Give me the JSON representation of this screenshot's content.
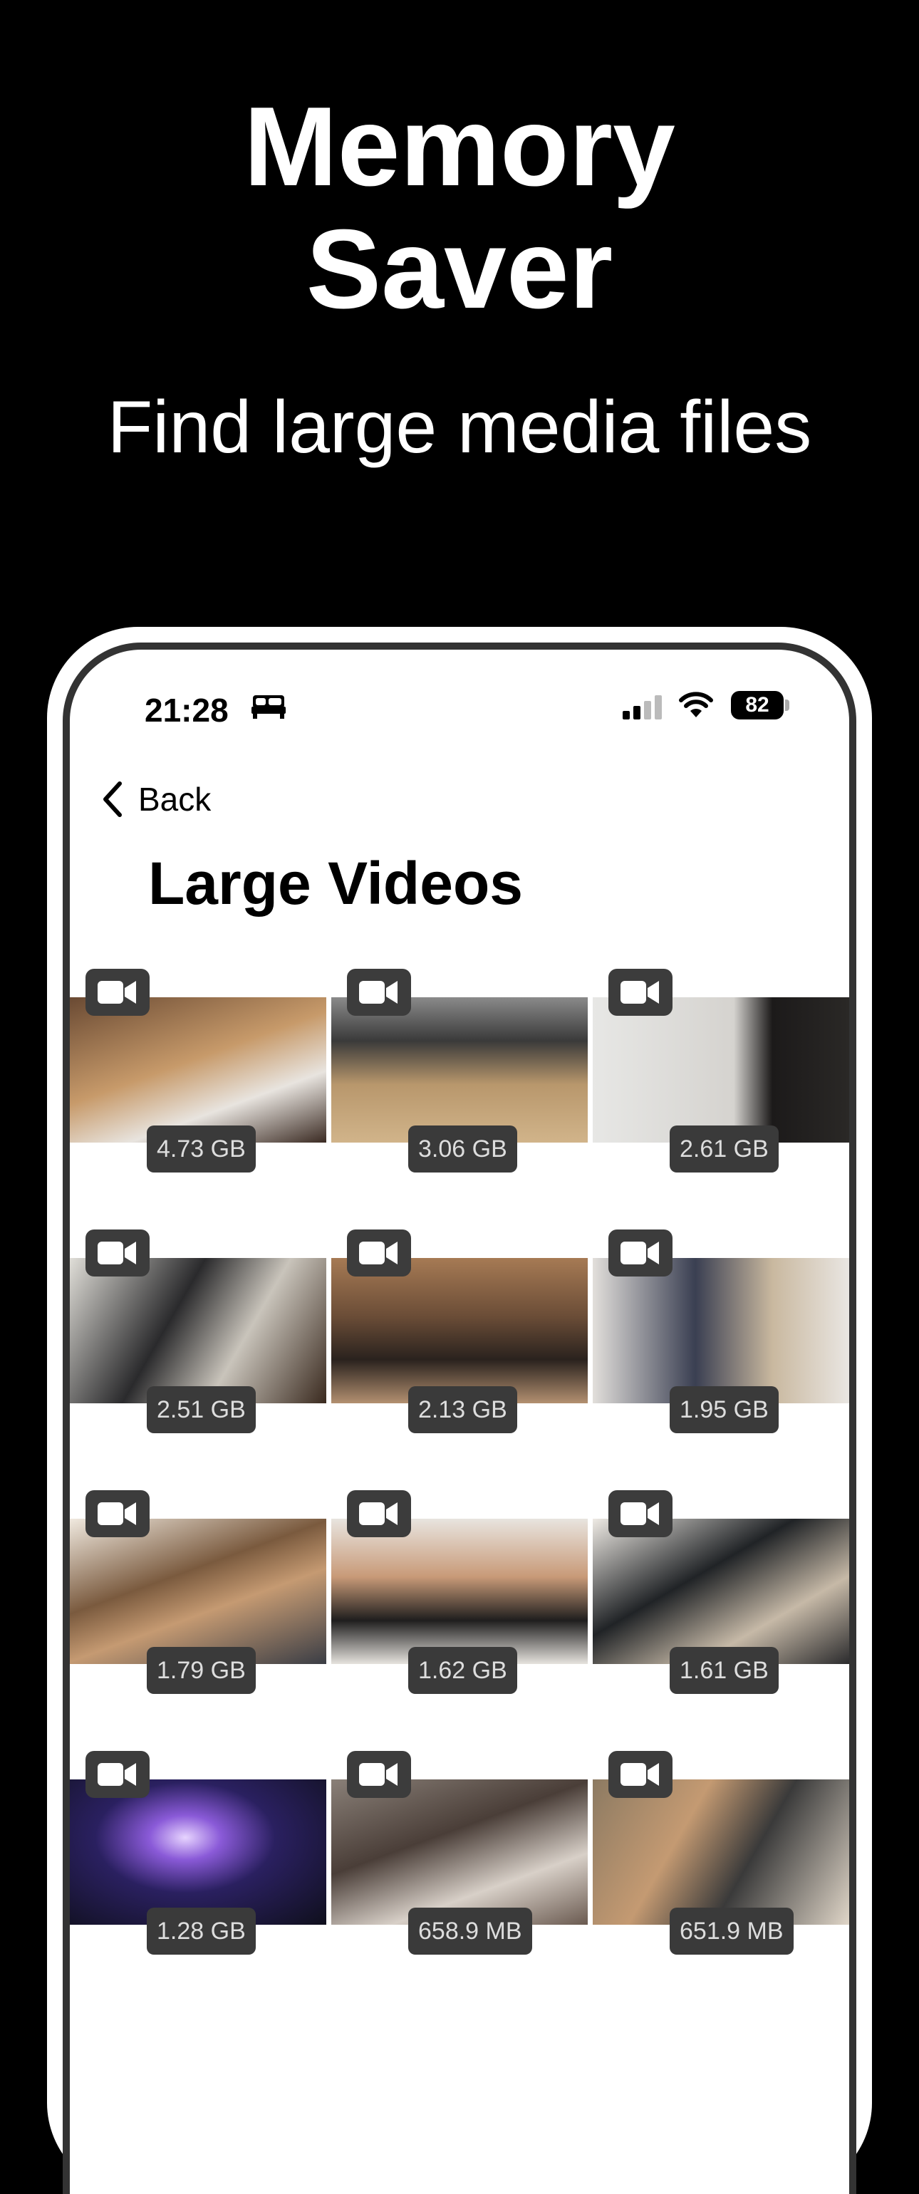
{
  "hero": {
    "title_line1": "Memory",
    "title_line2": "Saver",
    "subtitle": "Find large media files"
  },
  "status_bar": {
    "time": "21:28",
    "battery": "82",
    "icons": [
      "bed-icon",
      "signal-icon",
      "wifi-icon",
      "battery-icon"
    ]
  },
  "nav": {
    "back_label": "Back",
    "back_icon": "chevron-left-icon"
  },
  "page": {
    "title": "Large Videos"
  },
  "videos": [
    {
      "size": "4.73 GB",
      "icon": "video-camera-icon"
    },
    {
      "size": "3.06 GB",
      "icon": "video-camera-icon"
    },
    {
      "size": "2.61 GB",
      "icon": "video-camera-icon"
    },
    {
      "size": "2.51 GB",
      "icon": "video-camera-icon"
    },
    {
      "size": "2.13 GB",
      "icon": "video-camera-icon"
    },
    {
      "size": "1.95 GB",
      "icon": "video-camera-icon"
    },
    {
      "size": "1.79 GB",
      "icon": "video-camera-icon"
    },
    {
      "size": "1.62 GB",
      "icon": "video-camera-icon"
    },
    {
      "size": "1.61 GB",
      "icon": "video-camera-icon"
    },
    {
      "size": "1.28 GB",
      "icon": "video-camera-icon"
    },
    {
      "size": "658.9 MB",
      "icon": "video-camera-icon"
    },
    {
      "size": "651.9 MB",
      "icon": "video-camera-icon"
    }
  ]
}
